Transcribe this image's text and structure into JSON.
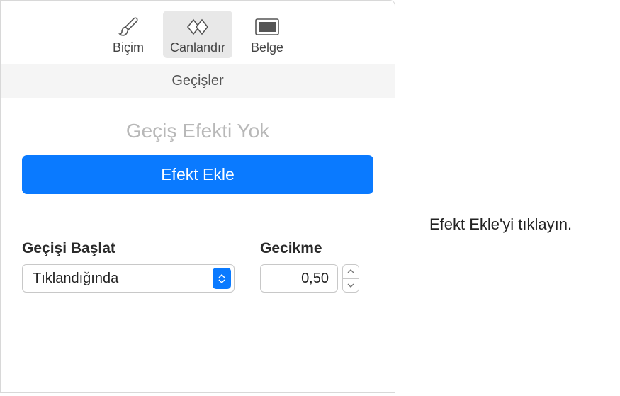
{
  "toolbar": {
    "format": {
      "label": "Biçim"
    },
    "animate": {
      "label": "Canlandır"
    },
    "document": {
      "label": "Belge"
    }
  },
  "section": {
    "transitions_label": "Geçişler"
  },
  "transitions": {
    "no_effect_title": "Geçiş Efekti Yok",
    "add_effect_label": "Efekt Ekle"
  },
  "controls": {
    "start_transition": {
      "label": "Geçişi Başlat",
      "value": "Tıklandığında"
    },
    "delay": {
      "label": "Gecikme",
      "value": "0,50"
    }
  },
  "callout": {
    "text": "Efekt Ekle'yi tıklayın."
  }
}
